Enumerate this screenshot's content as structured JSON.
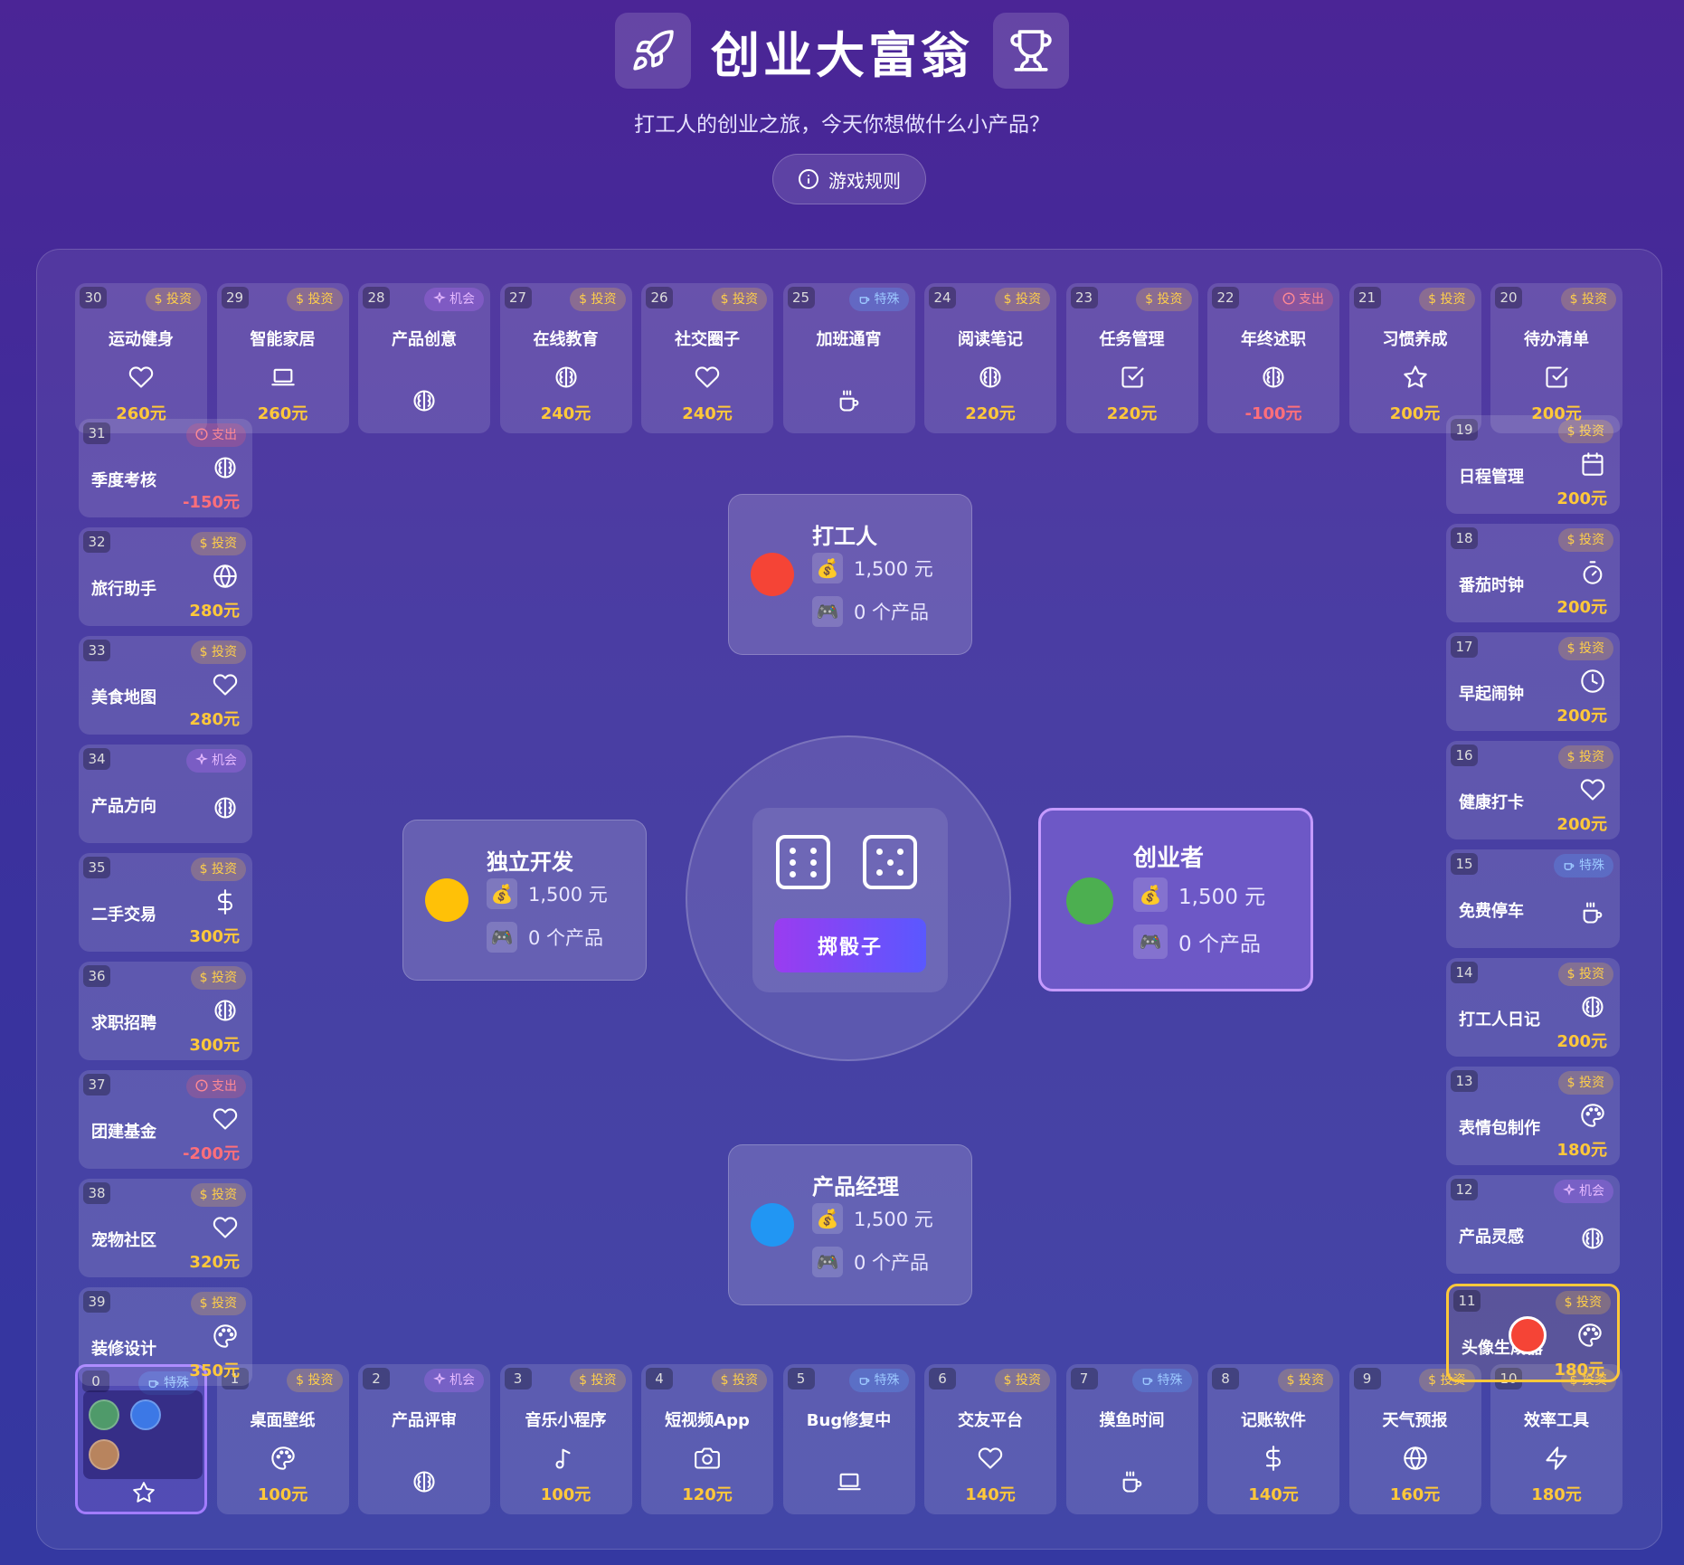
{
  "header": {
    "title": "创业大富翁",
    "subtitle": "打工人的创业之旅，今天你想做什么小产品？",
    "rules_label": "游戏规则"
  },
  "colors": {
    "accent": "#8b5cf6",
    "invest": "#ffc83a",
    "expense": "#ff6f7a",
    "red": "#f54436",
    "yellow": "#ffc107",
    "green": "#4caf50",
    "blue": "#2196f3"
  },
  "tiles": [
    {
      "index": "0",
      "badge": "特殊",
      "type": "special",
      "icon": "star-icon"
    },
    {
      "index": "1",
      "name": "桌面壁纸",
      "badge": "$ 投资",
      "type": "invest",
      "price": "100元",
      "icon": "palette-icon"
    },
    {
      "index": "2",
      "name": "产品评审",
      "badge": "机会",
      "type": "opportunity",
      "icon": "brain-icon"
    },
    {
      "index": "3",
      "name": "音乐小程序",
      "badge": "$ 投资",
      "type": "invest",
      "price": "100元",
      "icon": "music-icon"
    },
    {
      "index": "4",
      "name": "短视频App",
      "badge": "$ 投资",
      "type": "invest",
      "price": "120元",
      "icon": "camera-icon"
    },
    {
      "index": "5",
      "name": "Bug修复中",
      "badge": "特殊",
      "type": "special",
      "icon": "laptop-icon"
    },
    {
      "index": "6",
      "name": "交友平台",
      "badge": "$ 投资",
      "type": "invest",
      "price": "140元",
      "icon": "heart-icon"
    },
    {
      "index": "7",
      "name": "摸鱼时间",
      "badge": "特殊",
      "type": "special",
      "icon": "coffee-icon"
    },
    {
      "index": "8",
      "name": "记账软件",
      "badge": "$ 投资",
      "type": "invest",
      "price": "140元",
      "icon": "dollar-icon"
    },
    {
      "index": "9",
      "name": "天气预报",
      "badge": "$ 投资",
      "type": "invest",
      "price": "160元",
      "icon": "globe-icon"
    },
    {
      "index": "10",
      "name": "效率工具",
      "badge": "$ 投资",
      "type": "invest",
      "price": "180元",
      "icon": "lightning-icon"
    },
    {
      "index": "11",
      "name": "头像生成器",
      "badge": "$ 投资",
      "type": "invest",
      "price": "180元",
      "icon": "palette-icon"
    },
    {
      "index": "12",
      "name": "产品灵感",
      "badge": "机会",
      "type": "opportunity",
      "icon": "brain-icon"
    },
    {
      "index": "13",
      "name": "表情包制作",
      "badge": "$ 投资",
      "type": "invest",
      "price": "180元",
      "icon": "palette-icon"
    },
    {
      "index": "14",
      "name": "打工人日记",
      "badge": "$ 投资",
      "type": "invest",
      "price": "200元",
      "icon": "brain-icon"
    },
    {
      "index": "15",
      "name": "免费停车",
      "badge": "特殊",
      "type": "special",
      "icon": "coffee-icon"
    },
    {
      "index": "16",
      "name": "健康打卡",
      "badge": "$ 投资",
      "type": "invest",
      "price": "200元",
      "icon": "heart-icon"
    },
    {
      "index": "17",
      "name": "早起闹钟",
      "badge": "$ 投资",
      "type": "invest",
      "price": "200元",
      "icon": "clock-icon"
    },
    {
      "index": "18",
      "name": "番茄时钟",
      "badge": "$ 投资",
      "type": "invest",
      "price": "200元",
      "icon": "timer-icon"
    },
    {
      "index": "19",
      "name": "日程管理",
      "badge": "$ 投资",
      "type": "invest",
      "price": "200元",
      "icon": "calendar-icon"
    },
    {
      "index": "20",
      "name": "待办清单",
      "badge": "$ 投资",
      "type": "invest",
      "price": "200元",
      "icon": "checkbox-icon"
    },
    {
      "index": "21",
      "name": "习惯养成",
      "badge": "$ 投资",
      "type": "invest",
      "price": "200元",
      "icon": "star-icon"
    },
    {
      "index": "22",
      "name": "年终述职",
      "badge": "支出",
      "type": "expense",
      "price": "-100元",
      "icon": "brain-icon"
    },
    {
      "index": "23",
      "name": "任务管理",
      "badge": "$ 投资",
      "type": "invest",
      "price": "220元",
      "icon": "checkbox-icon"
    },
    {
      "index": "24",
      "name": "阅读笔记",
      "badge": "$ 投资",
      "type": "invest",
      "price": "220元",
      "icon": "brain-icon"
    },
    {
      "index": "25",
      "name": "加班通宵",
      "badge": "特殊",
      "type": "special",
      "icon": "coffee-icon"
    },
    {
      "index": "26",
      "name": "社交圈子",
      "badge": "$ 投资",
      "type": "invest",
      "price": "240元",
      "icon": "heart-icon"
    },
    {
      "index": "27",
      "name": "在线教育",
      "badge": "$ 投资",
      "type": "invest",
      "price": "240元",
      "icon": "brain-icon"
    },
    {
      "index": "28",
      "name": "产品创意",
      "badge": "机会",
      "type": "opportunity",
      "icon": "brain-icon"
    },
    {
      "index": "29",
      "name": "智能家居",
      "badge": "$ 投资",
      "type": "invest",
      "price": "260元",
      "icon": "laptop-icon"
    },
    {
      "index": "30",
      "name": "运动健身",
      "badge": "$ 投资",
      "type": "invest",
      "price": "260元",
      "icon": "heart-icon"
    },
    {
      "index": "31",
      "name": "季度考核",
      "badge": "支出",
      "type": "expense",
      "price": "-150元",
      "icon": "brain-icon"
    },
    {
      "index": "32",
      "name": "旅行助手",
      "badge": "$ 投资",
      "type": "invest",
      "price": "280元",
      "icon": "globe-icon"
    },
    {
      "index": "33",
      "name": "美食地图",
      "badge": "$ 投资",
      "type": "invest",
      "price": "280元",
      "icon": "heart-icon"
    },
    {
      "index": "34",
      "name": "产品方向",
      "badge": "机会",
      "type": "opportunity",
      "icon": "brain-icon"
    },
    {
      "index": "35",
      "name": "二手交易",
      "badge": "$ 投资",
      "type": "invest",
      "price": "300元",
      "icon": "dollar-icon"
    },
    {
      "index": "36",
      "name": "求职招聘",
      "badge": "$ 投资",
      "type": "invest",
      "price": "300元",
      "icon": "brain-icon"
    },
    {
      "index": "37",
      "name": "团建基金",
      "badge": "支出",
      "type": "expense",
      "price": "-200元",
      "icon": "heart-icon"
    },
    {
      "index": "38",
      "name": "宠物社区",
      "badge": "$ 投资",
      "type": "invest",
      "price": "320元",
      "icon": "heart-icon"
    },
    {
      "index": "39",
      "name": "装修设计",
      "badge": "$ 投资",
      "type": "invest",
      "price": "350元",
      "icon": "palette-icon"
    }
  ],
  "players": [
    {
      "name": "打工人",
      "money": "1,500 元",
      "products": "0 个产品",
      "color": "#f54436",
      "money_icon": "💰",
      "product_icon": "🎮"
    },
    {
      "name": "独立开发",
      "money": "1,500 元",
      "products": "0 个产品",
      "color": "#ffc107",
      "money_icon": "💰",
      "product_icon": "🎮"
    },
    {
      "name": "创业者",
      "money": "1,500 元",
      "products": "0 个产品",
      "color": "#4caf50",
      "money_icon": "💰",
      "product_icon": "🎮"
    },
    {
      "name": "产品经理",
      "money": "1,500 元",
      "products": "0 个产品",
      "color": "#2196f3",
      "money_icon": "💰",
      "product_icon": "🎮"
    }
  ],
  "dice": {
    "values": [
      6,
      5
    ],
    "button_label": "掷骰子"
  }
}
